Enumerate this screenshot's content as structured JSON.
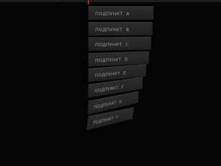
{
  "submenu": {
    "items": [
      {
        "label": "ПОДПУНКТ",
        "key": "A"
      },
      {
        "label": "ПОДПУНКТ",
        "key": "B"
      },
      {
        "label": "ПОДПУНКТ",
        "key": "C"
      },
      {
        "label": "ПОДПУНКТ",
        "key": "D"
      },
      {
        "label": "ПОДПУНКТ",
        "key": "E"
      },
      {
        "label": "ПОДПУНКТ",
        "key": "F"
      },
      {
        "label": "ПОДПУНКТ",
        "key": "G"
      },
      {
        "label": "ПОДПУНКТ",
        "key": "Y"
      }
    ]
  },
  "colors": {
    "background": "#050505",
    "item": "#262626",
    "active_accent": "#b0302a",
    "label": "#9a9a9a"
  }
}
